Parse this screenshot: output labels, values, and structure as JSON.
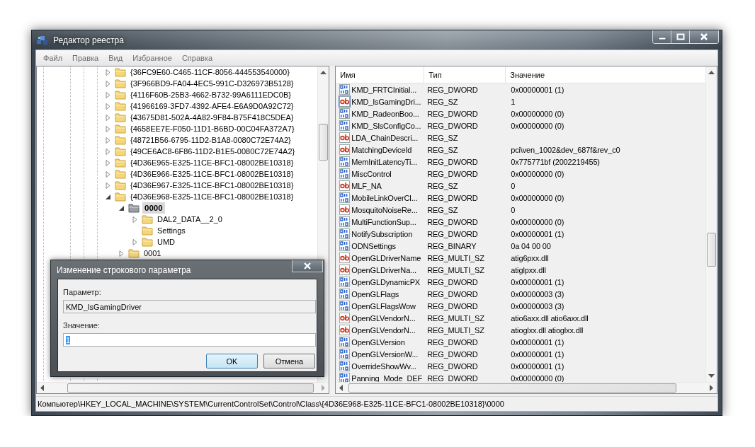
{
  "window": {
    "title": "Редактор реестра"
  },
  "menu": [
    "Файл",
    "Правка",
    "Вид",
    "Избранное",
    "Справка"
  ],
  "tree": {
    "items": [
      {
        "label": "{36FC9E60-C465-11CF-8056-444553540000}",
        "has_children": true,
        "expanded": false,
        "selected": false
      },
      {
        "label": "{3F966BD9-FA04-4EC5-991C-D326973B5128}",
        "has_children": true,
        "expanded": false,
        "selected": false
      },
      {
        "label": "{4116F60B-25B3-4662-B732-99A6111EDC0B}",
        "has_children": true,
        "expanded": false,
        "selected": false
      },
      {
        "label": "{41966169-3FD7-4392-AFE4-E6A9D0A92C72}",
        "has_children": true,
        "expanded": false,
        "selected": false
      },
      {
        "label": "{43675D81-502A-4A82-9F84-B75F418C5DEA}",
        "has_children": true,
        "expanded": false,
        "selected": false
      },
      {
        "label": "{4658EE7E-F050-11D1-B6BD-00C04FA372A7}",
        "has_children": true,
        "expanded": false,
        "selected": false
      },
      {
        "label": "{48721B56-6795-11D2-B1A8-0080C72E74A2}",
        "has_children": true,
        "expanded": false,
        "selected": false
      },
      {
        "label": "{49CE6AC8-6F86-11D2-B1E5-0080C72E74A2}",
        "has_children": true,
        "expanded": false,
        "selected": false
      },
      {
        "label": "{4D36E965-E325-11CE-BFC1-08002BE10318}",
        "has_children": true,
        "expanded": false,
        "selected": false
      },
      {
        "label": "{4D36E966-E325-11CE-BFC1-08002BE10318}",
        "has_children": true,
        "expanded": false,
        "selected": false
      },
      {
        "label": "{4D36E967-E325-11CE-BFC1-08002BE10318}",
        "has_children": true,
        "expanded": false,
        "selected": false
      },
      {
        "label": "{4D36E968-E325-11CE-BFC1-08002BE10318}",
        "has_children": true,
        "expanded": true,
        "selected": false,
        "children": [
          {
            "label": "0000",
            "has_children": true,
            "expanded": true,
            "selected": true,
            "children": [
              {
                "label": "DAL2_DATA__2_0",
                "has_children": true,
                "expanded": false,
                "selected": false
              },
              {
                "label": "Settings",
                "has_children": false,
                "selected": false
              },
              {
                "label": "UMD",
                "has_children": true,
                "expanded": false,
                "selected": false
              }
            ]
          },
          {
            "label": "0001",
            "has_children": true,
            "expanded": false,
            "selected": false
          }
        ]
      }
    ]
  },
  "list": {
    "columns": [
      "Имя",
      "Тип",
      "Значение"
    ],
    "rows": [
      {
        "kind": "binary",
        "name": "KMD_FRTCInitial...",
        "type": "REG_DWORD",
        "value": "0x00000001 (1)",
        "selected": false
      },
      {
        "kind": "string",
        "name": "KMD_IsGamingDri...",
        "type": "REG_SZ",
        "value": "1",
        "selected": true
      },
      {
        "kind": "binary",
        "name": "KMD_RadeonBoo...",
        "type": "REG_DWORD",
        "value": "0x00000000 (0)",
        "selected": false
      },
      {
        "kind": "binary",
        "name": "KMD_SlsConfigCo...",
        "type": "REG_DWORD",
        "value": "0x00000000 (0)",
        "selected": false
      },
      {
        "kind": "string",
        "name": "LDA_ChainDescri...",
        "type": "REG_SZ",
        "selected": false
      },
      {
        "kind": "string",
        "name": "MatchingDeviceId",
        "type": "REG_SZ",
        "value": "pci\\ven_1002&dev_687f&rev_c0",
        "selected": false
      },
      {
        "kind": "binary",
        "name": "MemInitLatencyTi...",
        "type": "REG_DWORD",
        "value": "0x775771bf (2002219455)",
        "selected": false
      },
      {
        "kind": "binary",
        "name": "MiscControl",
        "type": "REG_DWORD",
        "value": "0x00000000 (0)",
        "selected": false
      },
      {
        "kind": "string",
        "name": "MLF_NA",
        "type": "REG_SZ",
        "value": "0",
        "selected": false
      },
      {
        "kind": "binary",
        "name": "MobileLinkOverCl...",
        "type": "REG_DWORD",
        "value": "0x00000000 (0)",
        "selected": false
      },
      {
        "kind": "string",
        "name": "MosquitoNoiseRe...",
        "type": "REG_SZ",
        "value": "0",
        "selected": false
      },
      {
        "kind": "binary",
        "name": "MultiFunctionSup...",
        "type": "REG_DWORD",
        "value": "0x00000000 (0)",
        "selected": false
      },
      {
        "kind": "binary",
        "name": "NotifySubscription",
        "type": "REG_DWORD",
        "value": "0x00000001 (1)",
        "selected": false
      },
      {
        "kind": "binary",
        "name": "ODNSettings",
        "type": "REG_BINARY",
        "value": "0a 04 00 00",
        "selected": false
      },
      {
        "kind": "string",
        "name": "OpenGLDriverName",
        "type": "REG_MULTI_SZ",
        "value": "atig6pxx.dll",
        "selected": false
      },
      {
        "kind": "string",
        "name": "OpenGLDriverNa...",
        "type": "REG_MULTI_SZ",
        "value": "atiglpxx.dll",
        "selected": false
      },
      {
        "kind": "binary",
        "name": "OpenGLDynamicPX",
        "type": "REG_DWORD",
        "value": "0x00000001 (1)",
        "selected": false
      },
      {
        "kind": "binary",
        "name": "OpenGLFlags",
        "type": "REG_DWORD",
        "value": "0x00000003 (3)",
        "selected": false
      },
      {
        "kind": "binary",
        "name": "OpenGLFlagsWow",
        "type": "REG_DWORD",
        "value": "0x00000003 (3)",
        "selected": false
      },
      {
        "kind": "string",
        "name": "OpenGLVendorN...",
        "type": "REG_MULTI_SZ",
        "value": "atio6axx.dll atio6axx.dll",
        "selected": false
      },
      {
        "kind": "string",
        "name": "OpenGLVendorN...",
        "type": "REG_MULTI_SZ",
        "value": "atioglxx.dll atioglxx.dll",
        "selected": false
      },
      {
        "kind": "binary",
        "name": "OpenGLVersion",
        "type": "REG_DWORD",
        "value": "0x00000001 (1)",
        "selected": false
      },
      {
        "kind": "binary",
        "name": "OpenGLVersionW...",
        "type": "REG_DWORD",
        "value": "0x00000001 (1)",
        "selected": false
      },
      {
        "kind": "binary",
        "name": "OverrideShowWv...",
        "type": "REG_DWORD",
        "value": "0x00000001 (1)",
        "selected": false
      },
      {
        "kind": "binary",
        "name": "Panning_Mode_DEF",
        "type": "REG_DWORD",
        "value": "0x00000000 (0)",
        "selected": false
      }
    ]
  },
  "status_bar": "Компьютер\\HKEY_LOCAL_MACHINE\\SYSTEM\\CurrentControlSet\\Control\\Class\\{4D36E968-E325-11CE-BFC1-08002BE10318}\\0000",
  "dialog": {
    "title": "Изменение строкового параметра",
    "fields": [
      {
        "label": "Параметр:",
        "value": "KMD_IsGamingDriver",
        "disabled": true,
        "text_selected": false
      },
      {
        "label": "Значение:",
        "value": "1",
        "disabled": false,
        "text_selected": true
      }
    ],
    "buttons": [
      {
        "label": "OK",
        "default": true
      },
      {
        "label": "Отмена",
        "default": false
      }
    ]
  }
}
